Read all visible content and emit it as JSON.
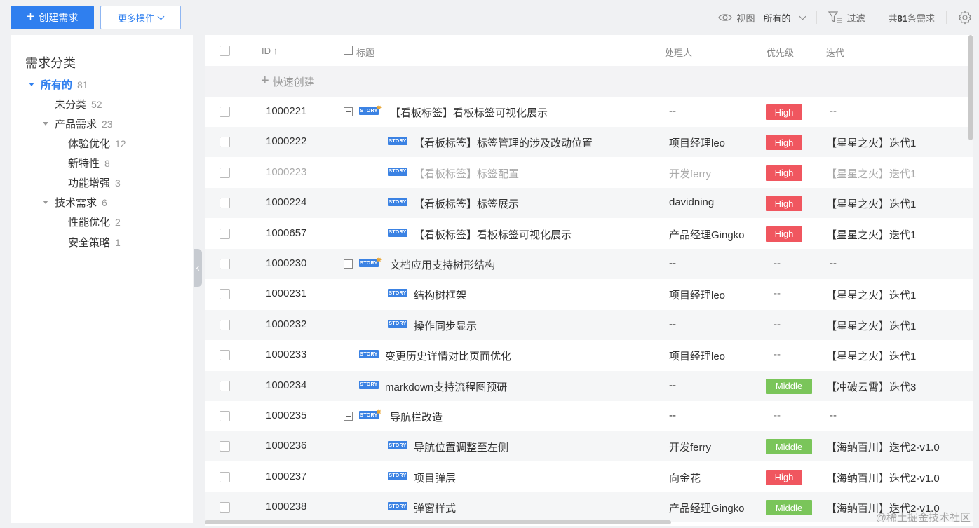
{
  "toolbar": {
    "create_label": "创建需求",
    "more_label": "更多操作",
    "view_label": "视图",
    "view_value": "所有的",
    "filter_label": "过滤",
    "total_prefix": "共",
    "total_count": "81",
    "total_suffix": "条需求"
  },
  "sidebar": {
    "title": "需求分类",
    "items": [
      {
        "label": "所有的",
        "count": "81"
      },
      {
        "label": "未分类",
        "count": "52"
      },
      {
        "label": "产品需求",
        "count": "23"
      },
      {
        "label": "体验优化",
        "count": "12"
      },
      {
        "label": "新特性",
        "count": "8"
      },
      {
        "label": "功能增强",
        "count": "3"
      },
      {
        "label": "技术需求",
        "count": "6"
      },
      {
        "label": "性能优化",
        "count": "2"
      },
      {
        "label": "安全策略",
        "count": "1"
      }
    ]
  },
  "table": {
    "headers": {
      "id": "ID ↑",
      "title": "标题",
      "owner": "处理人",
      "priority": "优先级",
      "iteration": "迭代"
    },
    "quick_create": "快速创建",
    "tag_label": "STORY",
    "rows": [
      {
        "id": "1000221",
        "title": "【看板标签】看板标签可视化展示",
        "owner": "--",
        "priority": "High",
        "iteration": "--"
      },
      {
        "id": "1000222",
        "title": "【看板标签】标签管理的涉及改动位置",
        "owner": "项目经理leo",
        "priority": "High",
        "iteration": "【星星之火】迭代1"
      },
      {
        "id": "1000223",
        "title": "【看板标签】标签配置",
        "owner": "开发ferry",
        "priority": "High",
        "iteration": "【星星之火】迭代1"
      },
      {
        "id": "1000224",
        "title": "【看板标签】标签展示",
        "owner": "davidning",
        "priority": "High",
        "iteration": "【星星之火】迭代1"
      },
      {
        "id": "1000657",
        "title": "【看板标签】看板标签可视化展示",
        "owner": "产品经理Gingko",
        "priority": "High",
        "iteration": "【星星之火】迭代1"
      },
      {
        "id": "1000230",
        "title": "文档应用支持树形结构",
        "owner": "--",
        "priority": "--",
        "iteration": "--"
      },
      {
        "id": "1000231",
        "title": "结构树框架",
        "owner": "项目经理leo",
        "priority": "--",
        "iteration": "【星星之火】迭代1"
      },
      {
        "id": "1000232",
        "title": "操作同步显示",
        "owner": "--",
        "priority": "--",
        "iteration": "【星星之火】迭代1"
      },
      {
        "id": "1000233",
        "title": "变更历史详情对比页面优化",
        "owner": "项目经理leo",
        "priority": "--",
        "iteration": "【星星之火】迭代1"
      },
      {
        "id": "1000234",
        "title": "markdown支持流程图预研",
        "owner": "--",
        "priority": "Middle",
        "iteration": "【冲破云霄】迭代3"
      },
      {
        "id": "1000235",
        "title": "导航栏改造",
        "owner": "--",
        "priority": "--",
        "iteration": "--"
      },
      {
        "id": "1000236",
        "title": "导航位置调整至左侧",
        "owner": "开发ferry",
        "priority": "Middle",
        "iteration": "【海纳百川】迭代2-v1.0"
      },
      {
        "id": "1000237",
        "title": "项目弹层",
        "owner": "向金花",
        "priority": "High",
        "iteration": "【海纳百川】迭代2-v1.0"
      },
      {
        "id": "1000238",
        "title": "弹窗样式",
        "owner": "产品经理Gingko",
        "priority": "Middle",
        "iteration": "【海纳百川】迭代2-v1.0"
      }
    ]
  },
  "watermark": "@稀土掘金技术社区",
  "colors": {
    "accent": "#2f7fef",
    "high": "#f0565f",
    "middle": "#7ac55a",
    "tag": "#3b82e3"
  }
}
